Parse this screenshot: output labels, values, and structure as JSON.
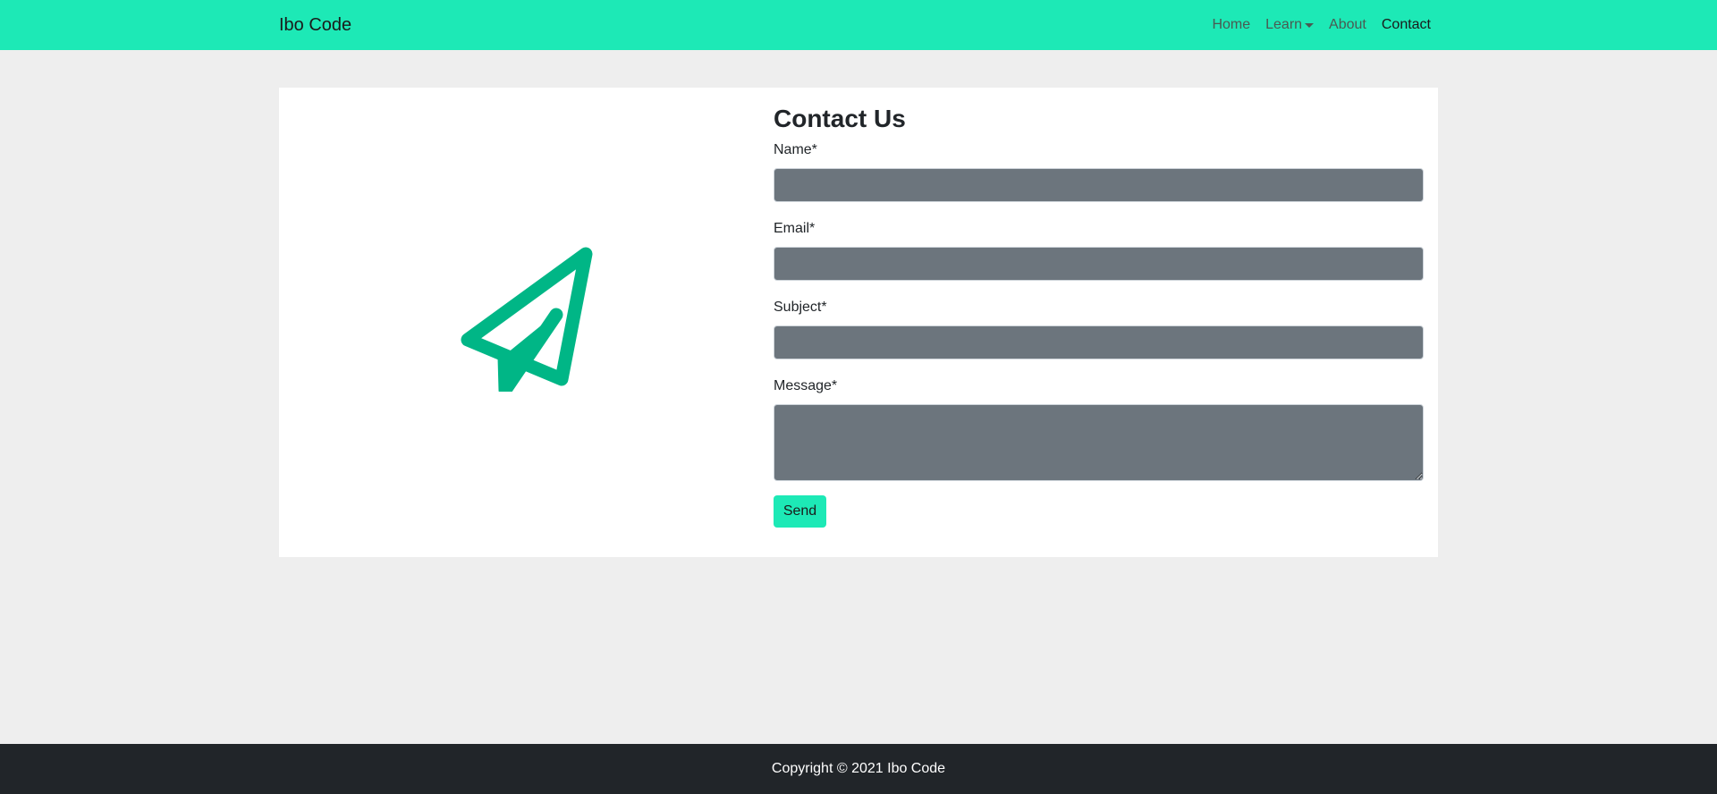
{
  "navbar": {
    "brand": "Ibo Code",
    "links": [
      {
        "label": "Home"
      },
      {
        "label": "Learn"
      },
      {
        "label": "About"
      },
      {
        "label": "Contact"
      }
    ]
  },
  "illustration": {
    "icon": "paper-plane-icon"
  },
  "form": {
    "title": "Contact Us",
    "name_label": "Name*",
    "email_label": "Email*",
    "subject_label": "Subject*",
    "message_label": "Message*",
    "send_label": "Send"
  },
  "footer": {
    "text": "Copyright © 2021 Ibo Code"
  },
  "colors": {
    "navbar": "#1de9b6",
    "accent_icon": "#00b686",
    "input_bg": "#6c757d",
    "footer_bg": "#212529",
    "page_bg": "#eeeeee"
  }
}
